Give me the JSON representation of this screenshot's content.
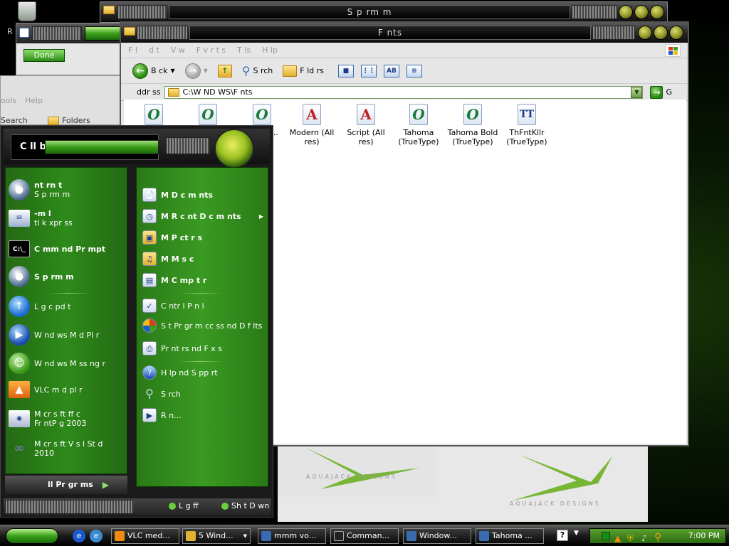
{
  "desktop": {
    "recycle_icon": "recycle-bin-icon",
    "done_label": "Done",
    "back_toolbar": {
      "tools_label": "ools",
      "help_label": "Help",
      "search_label": "Search",
      "folders_label": "Folders"
    },
    "letter_r": "R",
    "logo_text": "AQUAJACK DESIGNS"
  },
  "back_window": {
    "title": "S p rm   m"
  },
  "fonts_window": {
    "title": "F nts",
    "menu": [
      "F l",
      "d t",
      "V w",
      "F v r t s",
      "T  ls",
      "H lp"
    ],
    "toolbar": {
      "back_label": "B ck",
      "search_label": "S   rch",
      "folders_label": "F  ld rs"
    },
    "address": {
      "label": "ddr ss",
      "value": "C:\\W ND   WS\\F  nts",
      "go_label": "G"
    },
    "fonts": [
      {
        "name": "",
        "glyph": "O",
        "kind": "o"
      },
      {
        "name": "",
        "glyph": "O",
        "kind": "o"
      },
      {
        "name": "Sans T...",
        "glyph": "O",
        "kind": "o"
      },
      {
        "name": "Modern (All res)",
        "glyph": "A",
        "kind": "a"
      },
      {
        "name": "Script (All res)",
        "glyph": "A",
        "kind": "a"
      },
      {
        "name": "Tahoma (TrueType)",
        "glyph": "O",
        "kind": "o"
      },
      {
        "name": "Tahoma Bold (TrueType)",
        "glyph": "O",
        "kind": "o"
      },
      {
        "name": "ThFntKllr (TrueType)",
        "glyph": "TT",
        "kind": "t"
      }
    ]
  },
  "start_menu": {
    "user": "C ll bvM",
    "left_items": [
      {
        "line1": "nt rn t",
        "line2": "S p rm   m",
        "icon": "internet-icon",
        "bold": true
      },
      {
        "line1": "-m  l",
        "line2": " tl   k  xpr ss",
        "icon": "email-icon",
        "bold": true
      },
      {
        "line1": "C mm nd Pr mpt",
        "line2": "",
        "icon": "command-prompt-icon",
        "bold": true,
        "iconText": "C:\\_"
      },
      {
        "line1": "S p rm   m",
        "line2": "",
        "icon": "superman-icon",
        "bold": true
      },
      {
        "line1": "L g c   pd t",
        "line2": "",
        "icon": "update-icon",
        "bold": false
      },
      {
        "line1": "W nd ws M d   Pl   r",
        "line2": "",
        "icon": "media-player-icon",
        "bold": false
      },
      {
        "line1": "W nd ws M ss ng r",
        "line2": "",
        "icon": "messenger-icon",
        "bold": false
      },
      {
        "line1": "VLC m d   pl   r",
        "line2": "",
        "icon": "vlc-icon",
        "bold": false
      },
      {
        "line1": "M cr s ft   ff c",
        "line2": "Fr ntP g  2003",
        "icon": "frontpage-icon",
        "bold": false
      },
      {
        "line1": "M cr s ft V s  l St d",
        "line2": "2010",
        "icon": "visual-studio-icon",
        "bold": false
      }
    ],
    "all_programs": "ll Pr gr ms",
    "right_items": [
      {
        "label": "M  D c m nts",
        "icon": "my-documents-icon",
        "bold": true
      },
      {
        "label": "M  R c nt D c m nts",
        "icon": "recent-documents-icon",
        "bold": true
      },
      {
        "label": "M  P ct r s",
        "icon": "my-pictures-icon",
        "bold": true
      },
      {
        "label": "M  M s c",
        "icon": "my-music-icon",
        "bold": true
      },
      {
        "label": "M  C mp t r",
        "icon": "my-computer-icon",
        "bold": true
      },
      {
        "label": "C ntr l P n l",
        "icon": "control-panel-icon",
        "bold": false
      },
      {
        "label": "S t Pr gr m   cc ss  nd D f  lts",
        "icon": "program-access-icon",
        "bold": false
      },
      {
        "label": "Pr nt rs  nd F x s",
        "icon": "printers-icon",
        "bold": false
      },
      {
        "label": "H lp  nd S pp rt",
        "icon": "help-icon",
        "bold": false
      },
      {
        "label": "S   rch",
        "icon": "search-icon",
        "bold": false
      },
      {
        "label": "R n...",
        "icon": "run-icon",
        "bold": false
      }
    ],
    "logoff_label": "L g  ff",
    "shutdown_label": "Sh t D wn"
  },
  "taskbar": {
    "buttons": [
      {
        "label": "VLC med...",
        "color": "#f08a10"
      },
      {
        "label": "5 Wind...",
        "color": "#e0b030"
      },
      {
        "label": "mmm vo...",
        "color": "#3a6ab0"
      },
      {
        "label": "Comman...",
        "color": "#222222"
      },
      {
        "label": "Window...",
        "color": "#3a6ab0"
      },
      {
        "label": "Tahoma ...",
        "color": "#3a6ab0"
      }
    ],
    "clock": "7:00 PM"
  },
  "colors": {
    "accent": "#3a9a1a",
    "dark": "#1a1a1a"
  }
}
